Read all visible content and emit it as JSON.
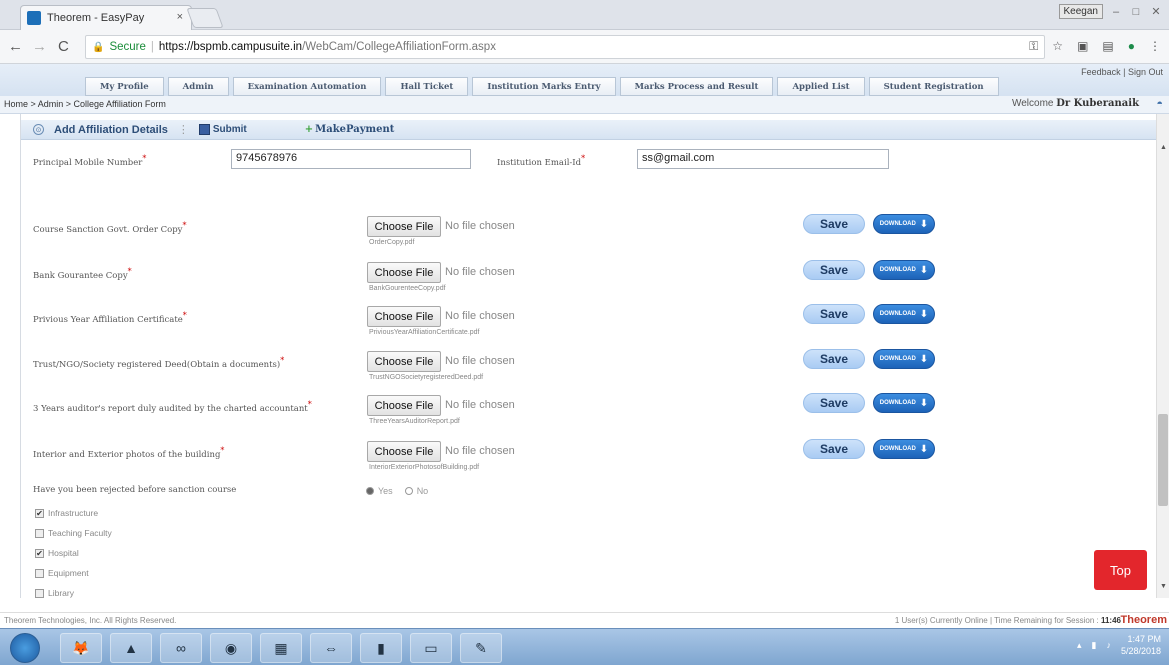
{
  "browser": {
    "tab_title": "Theorem - EasyPay",
    "tab_close": "×",
    "user_badge": "Keegan",
    "secure_label": "Secure",
    "url_host": "https://bspmb.campusuite.in",
    "url_path": "/WebCam/CollegeAffiliationForm.aspx"
  },
  "header": {
    "links": "Feedback | Sign Out",
    "menu": [
      "My Profile",
      "Admin",
      "Examination Automation",
      "Hall Ticket",
      "Institution Marks Entry",
      "Marks Process and Result",
      "Applied List",
      "Student Registration"
    ]
  },
  "breadcrumb": "Home > Admin > College Affiliation Form",
  "welcome": {
    "prefix": "Welcome",
    "user": "Dr Kuberanaik"
  },
  "section": {
    "title": "Add Affiliation Details",
    "submit": "Submit",
    "pay": "MakePayment"
  },
  "fields": {
    "mobile_label": "Principal Mobile Number",
    "mobile_value": "9745678976",
    "email_label": "Institution Email-Id",
    "email_value": "ss@gmail.com"
  },
  "uploads": [
    {
      "label": "Course Sanction Govt. Order Copy",
      "file": "OrderCopy.pdf"
    },
    {
      "label": "Bank Gourantee Copy",
      "file": "BankGourenteeCopy.pdf"
    },
    {
      "label": "Privious Year Affiliation Certificate",
      "file": "PriviousYearAffiliationCertificate.pdf"
    },
    {
      "label": "Trust/NGO/Society registered Deed(Obtain a documents)",
      "file": "TrustNGOSocietyregisteredDeed.pdf"
    },
    {
      "label": "3 Years auditor's report duly audited by the charted accountant",
      "file": "ThreeYearsAuditorReport.pdf"
    },
    {
      "label": "Interior and Exterior photos of the building",
      "file": "InteriorExteriorPhotosofBuilding.pdf"
    }
  ],
  "upload_ui": {
    "choose": "Choose File",
    "nofile": "No file chosen",
    "save": "Save",
    "download": "DOWNLOAD"
  },
  "rejected": {
    "question": "Have you been rejected before sanction course",
    "yes": "Yes",
    "no": "No"
  },
  "checkboxes": [
    {
      "label": "Infrastructure",
      "checked": true
    },
    {
      "label": "Teaching Faculty",
      "checked": false
    },
    {
      "label": "Hospital",
      "checked": true
    },
    {
      "label": "Equipment",
      "checked": false
    },
    {
      "label": "Library",
      "checked": false
    }
  ],
  "top_button": "Top",
  "footer": {
    "copyright": "Theorem Technologies, Inc. All Rights Reserved.",
    "online": "1 User(s) Currently Online | Time Remaining for Session : ",
    "time": "11:46",
    "brand": "Theorem"
  },
  "taskbar": {
    "time": "1:47 PM",
    "date": "5/28/2018"
  }
}
